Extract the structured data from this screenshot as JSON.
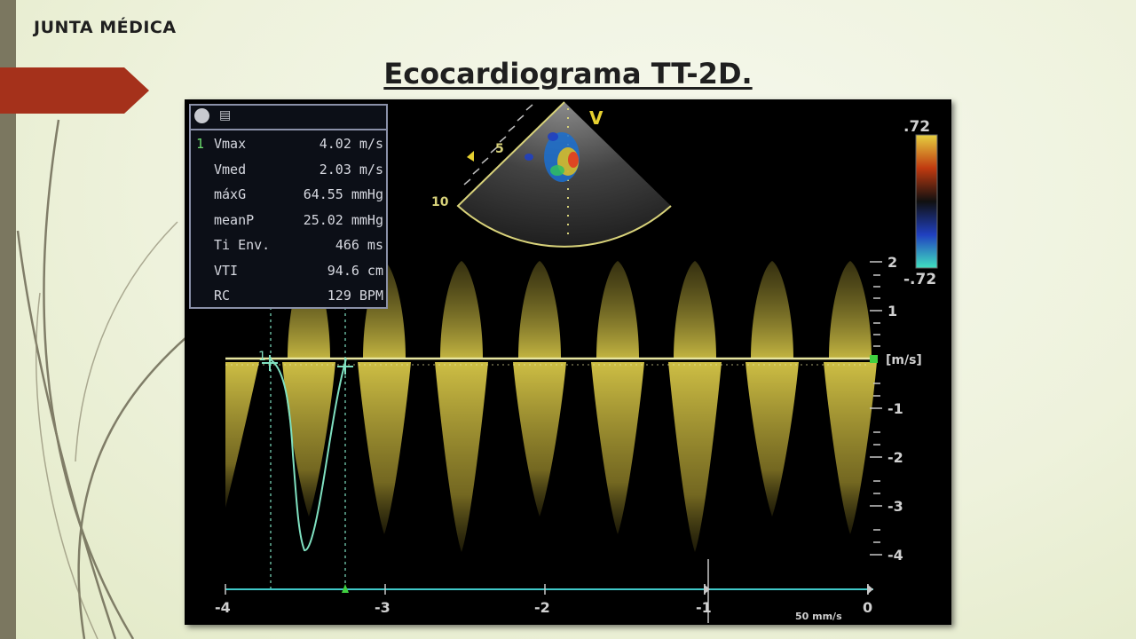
{
  "header": {
    "label": "JUNTA MÉDICA"
  },
  "slide": {
    "title": "Ecocardiograma TT-2D."
  },
  "measurements": {
    "rows": [
      {
        "idx": "1",
        "label": "Vmax",
        "value": "4.02 m/s"
      },
      {
        "idx": "",
        "label": "Vmed",
        "value": "2.03 m/s"
      },
      {
        "idx": "",
        "label": "máxG",
        "value": "64.55 mmHg"
      },
      {
        "idx": "",
        "label": "meanP",
        "value": "25.02 mmHg"
      },
      {
        "idx": "",
        "label": "Ti Env.",
        "value": "466 ms"
      },
      {
        "idx": "",
        "label": "VTI",
        "value": "94.6 cm"
      },
      {
        "idx": "",
        "label": "RC",
        "value": "129 BPM"
      }
    ]
  },
  "colorbar": {
    "top": ".72",
    "bottom": "-.72"
  },
  "sector": {
    "v_label": "V",
    "depth_5": "5",
    "depth_10": "10"
  },
  "velocity_axis": {
    "labels": [
      "2",
      "1",
      "[m/s]",
      "-1",
      "-2",
      "-3",
      "-4"
    ]
  },
  "time_axis": {
    "labels": [
      "-4",
      "-3",
      "-2",
      "-1",
      "0"
    ],
    "sweep": "50 mm/s"
  },
  "trace": {
    "marker": "1"
  },
  "colors": {
    "accent_red": "#a5311b",
    "doppler": "#c8b83a",
    "trace": "#7fe0c0",
    "baseline": "#e8e6a0"
  }
}
